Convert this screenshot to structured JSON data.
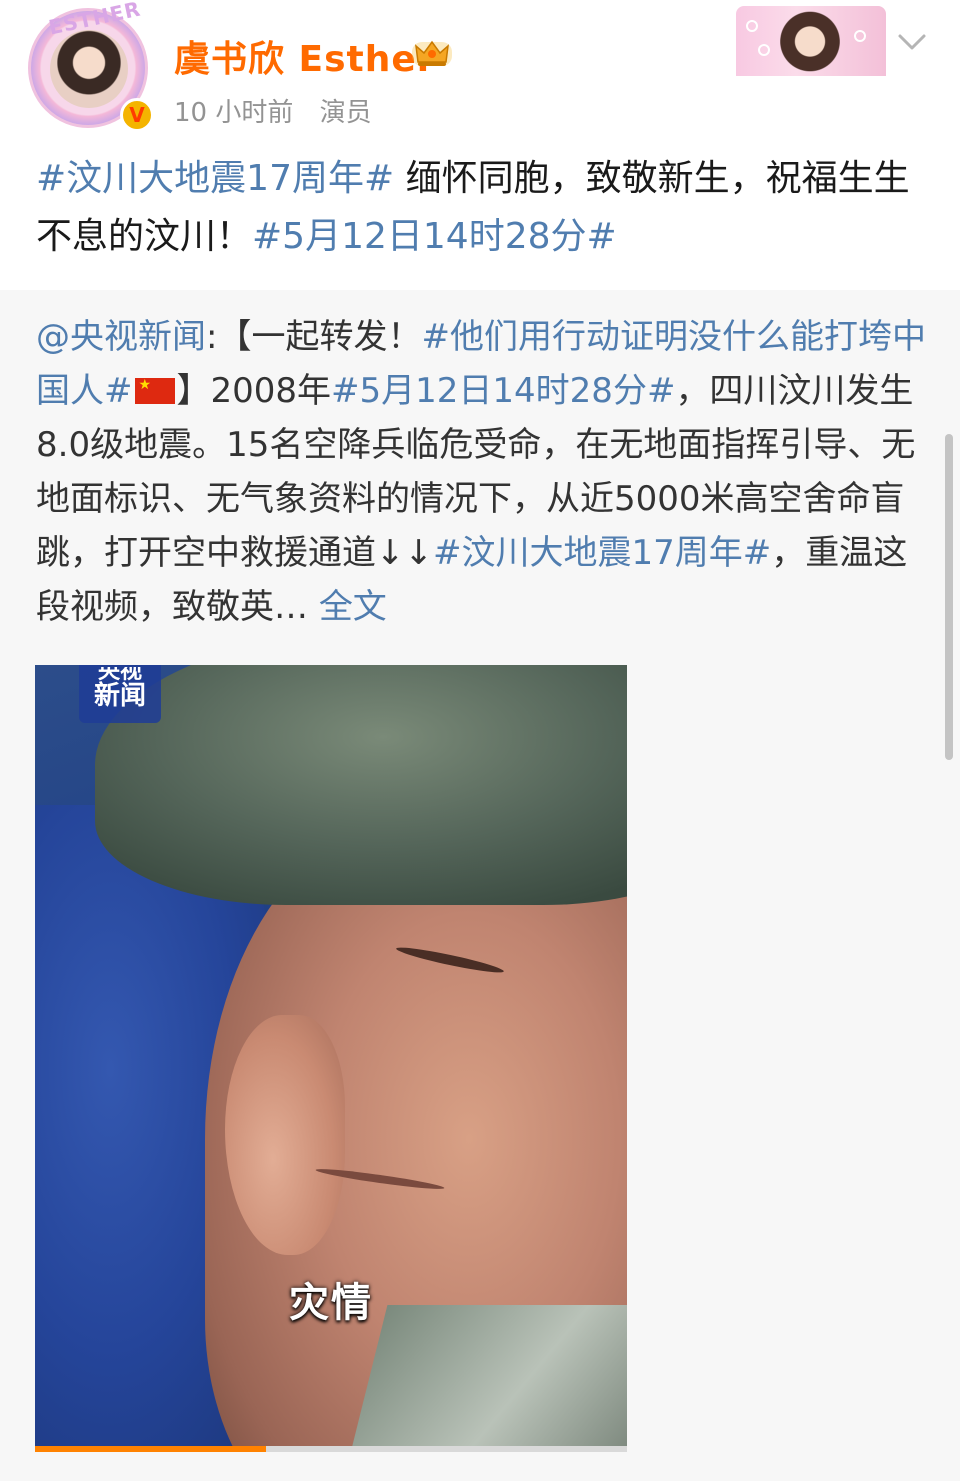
{
  "author": {
    "name": "虞书欣 Esther",
    "time": "10 小时前",
    "label": "演员",
    "avatar_frame_text": "ESTHER"
  },
  "post": {
    "topic1": "#汶川大地震17周年#",
    "body": " 缅怀同胞，致敬新生，祝福生生不息的汶川！",
    "topic2": "#5月12日14时28分#"
  },
  "repost": {
    "mention": "@央视新闻",
    "seg1": ":【一起转发！",
    "topic_a": "#他们用行动证明没什么能打垮中国人#",
    "seg2": "】2008年",
    "topic_b": "#5月12日14时28分#",
    "seg3": "，四川汶川发生8.0级地震。15名空降兵临危受命，在无地面指挥引导、无地面标识、无气象资料的情况下，从近5000米高空舍命盲跳，打开空中救援通道↓↓",
    "topic_c": "#汶川大地震17周年#",
    "seg4": "，重温这段视频，致敬英…",
    "full_text_link": "全文"
  },
  "video": {
    "station_logo_line1": "央视",
    "station_logo_line2": "新闻",
    "subtitle": "灾情",
    "progress": 0.39
  },
  "colors": {
    "username": "#ff6a00",
    "topic_link": "#507daf",
    "progress": "#ff8200"
  }
}
